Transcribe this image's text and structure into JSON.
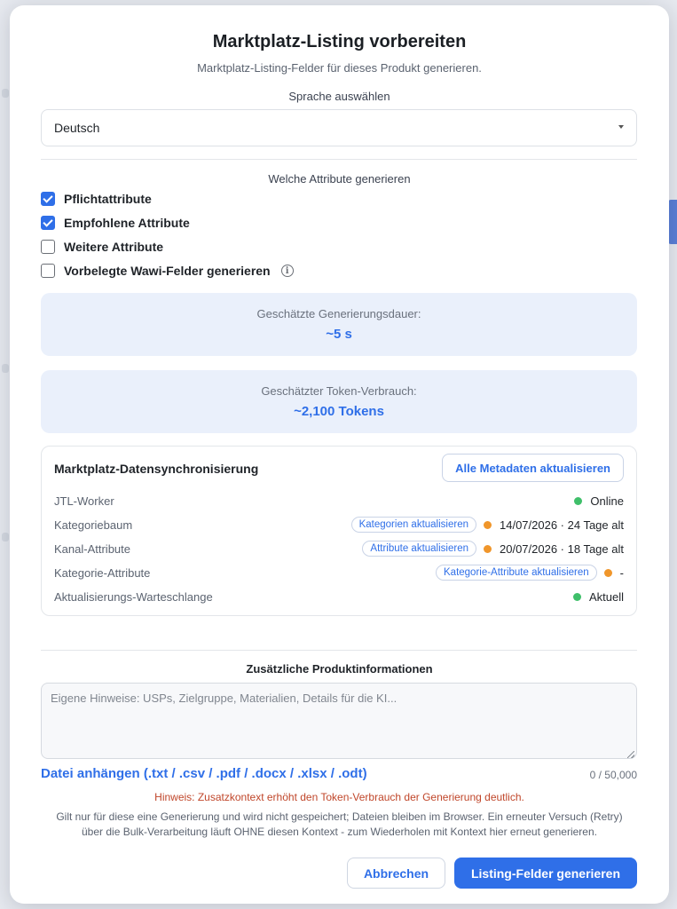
{
  "dialog": {
    "title": "Marktplatz-Listing vorbereiten",
    "subtitle": "Marktplatz-Listing-Felder für dieses Produkt generieren."
  },
  "language": {
    "label": "Sprache auswählen",
    "selected": "Deutsch"
  },
  "attributes": {
    "title": "Welche Attribute generieren",
    "options": [
      {
        "label": "Pflichtattribute",
        "checked": true
      },
      {
        "label": "Empfohlene Attribute",
        "checked": true
      },
      {
        "label": "Weitere Attribute",
        "checked": false
      },
      {
        "label": "Vorbelegte Wawi-Felder generieren",
        "checked": false,
        "info_icon": "info-icon"
      }
    ]
  },
  "estimates": {
    "duration_label": "Geschätzte Generierungsdauer:",
    "duration_value": "~5 s",
    "tokens_label": "Geschätzter Token-Verbrauch:",
    "tokens_value": "~2,100 Tokens"
  },
  "sync": {
    "title": "Marktplatz-Datensynchronisierung",
    "refresh_all_label": "Alle Metadaten aktualisieren",
    "rows": [
      {
        "label": "JTL-Worker",
        "action": "",
        "status_color": "green",
        "status": "Online"
      },
      {
        "label": "Kategoriebaum",
        "action": "Kategorien aktualisieren",
        "status_color": "orange",
        "status": "14/07/2026 · 24 Tage alt"
      },
      {
        "label": "Kanal-Attribute",
        "action": "Attribute aktualisieren",
        "status_color": "orange",
        "status": "20/07/2026 · 18 Tage alt"
      },
      {
        "label": "Kategorie-Attribute",
        "action": "Kategorie-Attribute aktualisieren",
        "status_color": "orange",
        "status": "-"
      },
      {
        "label": "Aktualisierungs-Warteschlange",
        "action": "",
        "status_color": "green",
        "status": "Aktuell"
      }
    ]
  },
  "extra": {
    "title": "Zusätzliche Produktinformationen",
    "placeholder": "Eigene Hinweise: USPs, Zielgruppe, Materialien, Details für die KI...",
    "attach_label": "Datei anhängen (.txt / .csv / .pdf / .docx / .xlsx / .odt)",
    "counter": "0 / 50,000",
    "warning": "Hinweis: Zusatzkontext erhöht den Token-Verbrauch der Generierung deutlich.",
    "note": "Gilt nur für diese eine Generierung und wird nicht gespeichert; Dateien bleiben im Browser. Ein erneuter Versuch (Retry) über die Bulk-Verarbeitung läuft OHNE diesen Kontext - zum Wiederholen mit Kontext hier erneut generieren."
  },
  "actions": {
    "cancel_label": "Abbrechen",
    "generate_label": "Listing-Felder generieren"
  },
  "colors": {
    "accent": "#2f6fe8",
    "status_green": "#3fbf6a",
    "status_orange": "#f0962b",
    "warning": "#c0462a"
  }
}
